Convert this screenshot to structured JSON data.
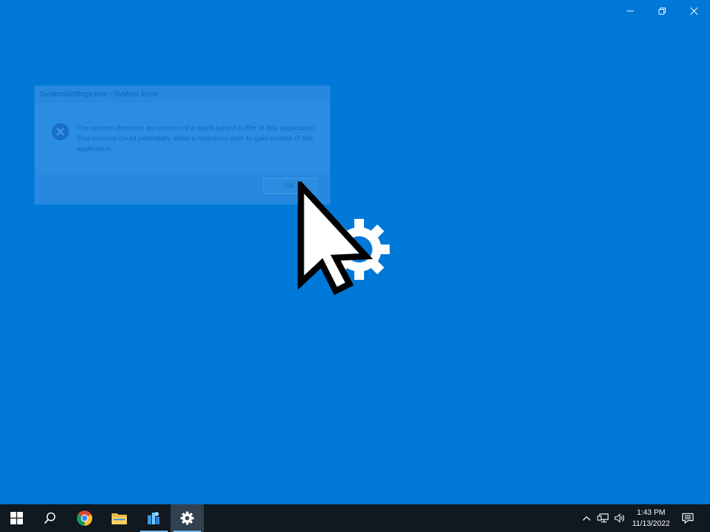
{
  "desktop": {
    "background_color": "#0078d7"
  },
  "window_controls": {
    "icons": [
      "minimize-icon",
      "restore-icon",
      "close-icon"
    ]
  },
  "error_dialog": {
    "title": "SystemSettings.exe - System Error",
    "message": "The system detected an overrun of a stack-based buffer in this application. This overrun could potentially allow a malicious user to gain control of this application.",
    "ok_label": "OK",
    "icon": "error-x-icon"
  },
  "center_graphic": {
    "icons": [
      "mouse-pointer-icon",
      "settings-gear-icon"
    ]
  },
  "taskbar": {
    "items": [
      {
        "name": "start-button",
        "icon": "windows-logo-icon"
      },
      {
        "name": "search-button",
        "icon": "search-icon"
      },
      {
        "name": "chrome-button",
        "icon": "chrome-icon"
      },
      {
        "name": "file-explorer-button",
        "icon": "folder-icon"
      },
      {
        "name": "app-button",
        "icon": "app-icon"
      },
      {
        "name": "settings-button",
        "icon": "gear-icon"
      }
    ],
    "tray": {
      "icons": [
        "chevron-up-icon",
        "network-icon",
        "volume-icon",
        "notification-icon"
      ],
      "time": "1:43 PM",
      "date": "11/13/2022"
    }
  }
}
